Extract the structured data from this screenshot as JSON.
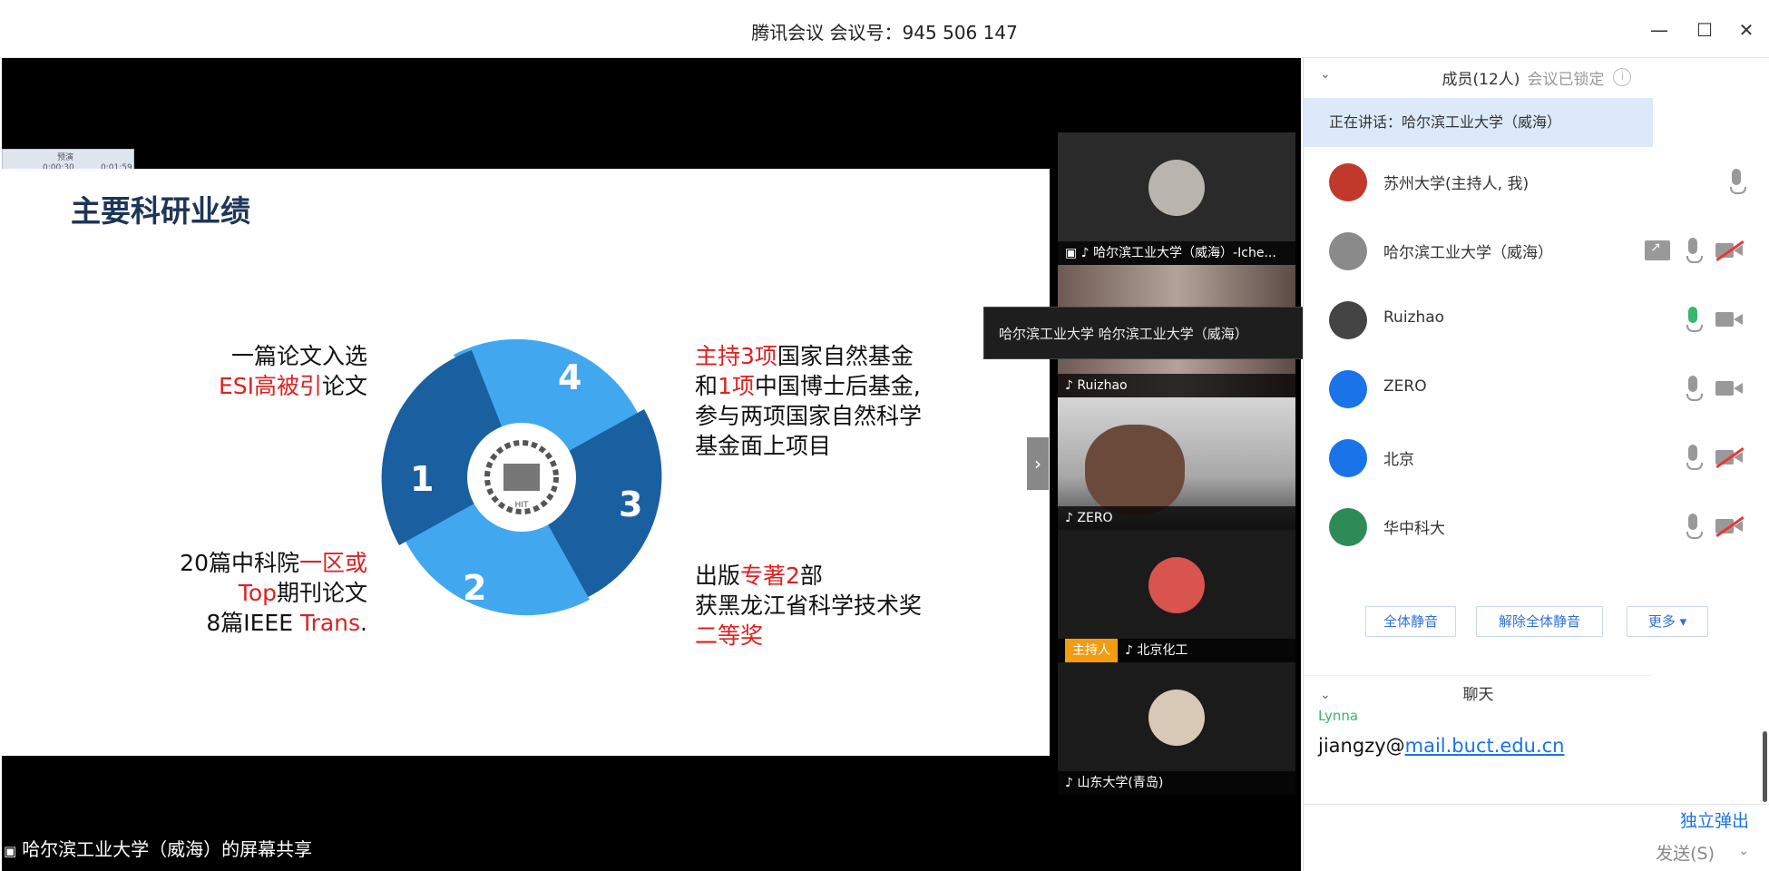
{
  "window": {
    "title": "腾讯会议 会议号：945 506 147",
    "minimize": "—",
    "maximize": "☐",
    "close": "✕"
  },
  "slide": {
    "title": "主要科研业绩",
    "segments": [
      "1",
      "2",
      "3",
      "4"
    ],
    "block_tl": {
      "l1": "一篇论文入选",
      "l2_red": "ESI高被引",
      "l2": "论文"
    },
    "block_bl": {
      "l1a": "20篇中科院",
      "l1_red": "一区或",
      "l2_red": "Top",
      "l2": "期刊论文",
      "l3a": "8篇IEEE ",
      "l3_red": "Trans",
      "l3b": "."
    },
    "block_tr": {
      "l1_red": "主持3项",
      "l1": "国家自然基金",
      "l2a": "和",
      "l2_red": "1项",
      "l2": "中国博士后基金,",
      "l3": "参与两项国家自然科学",
      "l4": "基金面上项目"
    },
    "block_br": {
      "l1a": "出版",
      "l1_red": "专著2",
      "l1b": "部",
      "l2": "获黑龙江省科学技术奖",
      "l3_red": "二等奖"
    },
    "colors": {
      "dark_blue": "#1a5fa0",
      "light_blue": "#41a8ef",
      "red": "#e02020"
    }
  },
  "ppt_controls": {
    "label": "预演",
    "time_elapsed": "0:00:30",
    "time_total": "0:01:59"
  },
  "expand_tab": "›",
  "video_tiles": [
    {
      "label": "▣ ♪ 哈尔滨工业大学（威海）-Iche..."
    },
    {
      "label": "♪ Ruizhao"
    },
    {
      "label": "♪ ZERO"
    },
    {
      "host": "主持人",
      "label": "♪ 北京化工"
    },
    {
      "label": "♪ 山东大学(青岛)"
    }
  ],
  "tooltip": "哈尔滨工业大学 哈尔滨工业大学（威海）",
  "share_label": "哈尔滨工业大学（威海）的屏幕共享",
  "panel": {
    "header": "成员(12人)",
    "locked": "会议已锁定",
    "banner": "正在讲话：哈尔滨工业大学（威海）",
    "members": [
      {
        "name": "苏州大学(主持人, 我)",
        "avatar_color": "#c0392b"
      },
      {
        "name": "哈尔滨工业大学（威海）",
        "avatar_color": "#8a8a8a"
      },
      {
        "name": "Ruizhao",
        "avatar_color": "#444"
      },
      {
        "name": "ZERO",
        "avatar_color": "#1a73e8"
      },
      {
        "name": "北京",
        "avatar_color": "#1a73e8"
      },
      {
        "name": "华中科大",
        "avatar_color": "#2e8b57"
      }
    ],
    "buttons": {
      "mute_all": "全体静音",
      "unmute_all": "解除全体静音",
      "more": "更多 ▾"
    },
    "chat_header": "聊天",
    "chat_sender": "Lynna",
    "chat_text": "jiangzy@",
    "chat_link": "mail.buct.edu.cn",
    "popout": "独立弹出",
    "send": "发送(S)",
    "send_arrow": "⌄"
  }
}
